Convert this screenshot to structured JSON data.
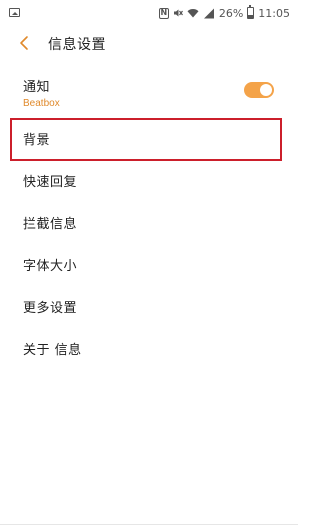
{
  "status_bar": {
    "battery_percent": "26%",
    "time": "11:05",
    "icons": [
      "gallery-icon",
      "nfc-icon",
      "mute-icon",
      "wifi-icon",
      "signal-icon",
      "battery-icon"
    ]
  },
  "header": {
    "title": "信息设置",
    "back_icon": "chevron-left-icon"
  },
  "settings": {
    "notify": {
      "label": "通知",
      "sub": "Beatbox",
      "toggle_on": true
    },
    "items": [
      {
        "label": "背景",
        "highlighted": true
      },
      {
        "label": "快速回复"
      },
      {
        "label": "拦截信息"
      },
      {
        "label": "字体大小"
      },
      {
        "label": "更多设置"
      },
      {
        "label": "关于 信息"
      }
    ]
  },
  "colors": {
    "accent": "#e08a2c",
    "toggle": "#f4a349",
    "highlight": "#cc1f2b"
  }
}
